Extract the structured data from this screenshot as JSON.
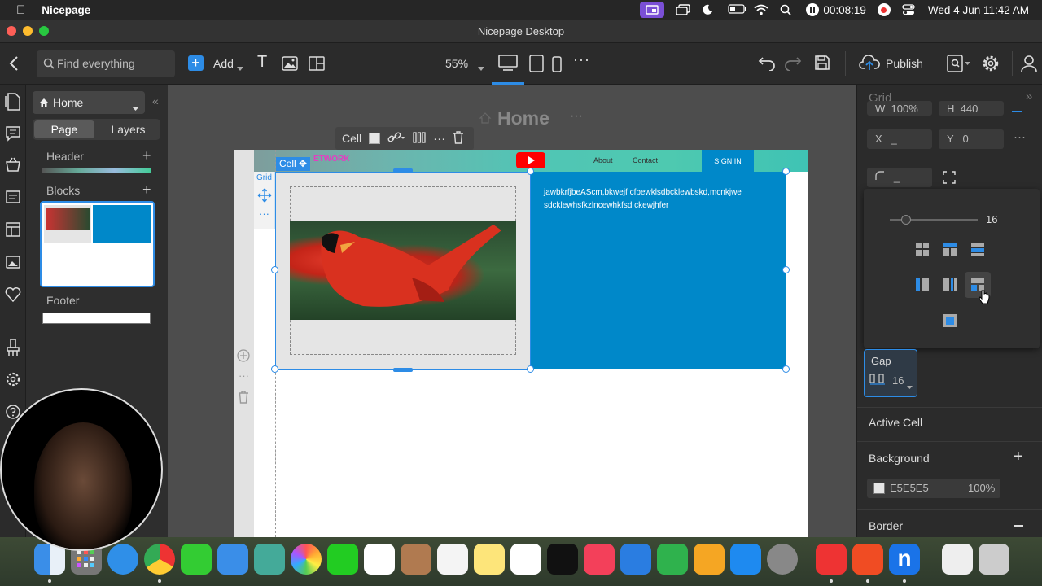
{
  "menubar": {
    "app_name": "Nicepage",
    "recorder_time": "00:08:19",
    "datetime": "Wed 4 Jun  11:42 AM"
  },
  "window": {
    "title": "Nicepage Desktop"
  },
  "toolbar": {
    "search_placeholder": "Find everything",
    "add_label": "Add",
    "zoom": "55%",
    "publish_label": "Publish"
  },
  "left_panel": {
    "page_select": "Home",
    "tabs": [
      "Page",
      "Layers"
    ],
    "header_label": "Header",
    "blocks_label": "Blocks",
    "footer_label": "Footer"
  },
  "canvas": {
    "page_title": "Home",
    "cell_toolbar_label": "Cell",
    "cell_tag": "Cell",
    "grid_tag": "Grid",
    "site_nav": [
      "About",
      "Contact"
    ],
    "site_button": "SIGN IN",
    "logo_text": "ETWORK",
    "cell_text": "jawbkrfjbeAScm,bkwejf cfbewklsdbcklewbskd,mcnkjwe sdcklewhsfkzlncewhkfsd ckewjhfer",
    "blue_color": "#0088c9",
    "cell_bg": "#e5e5e5"
  },
  "right_panel": {
    "title": "Grid",
    "w_label": "W",
    "w_value": "100%",
    "h_label": "H",
    "h_value": "440",
    "x_label": "X",
    "x_value": "_",
    "y_label": "Y",
    "y_value": "0",
    "radius_value": "_",
    "slider_value": "16",
    "gap_label": "Gap",
    "gap_value": "16",
    "active_cell_label": "Active Cell",
    "background_label": "Background",
    "bg_color_value": "E5E5E5",
    "bg_opacity": "100%",
    "border_label": "Border"
  }
}
